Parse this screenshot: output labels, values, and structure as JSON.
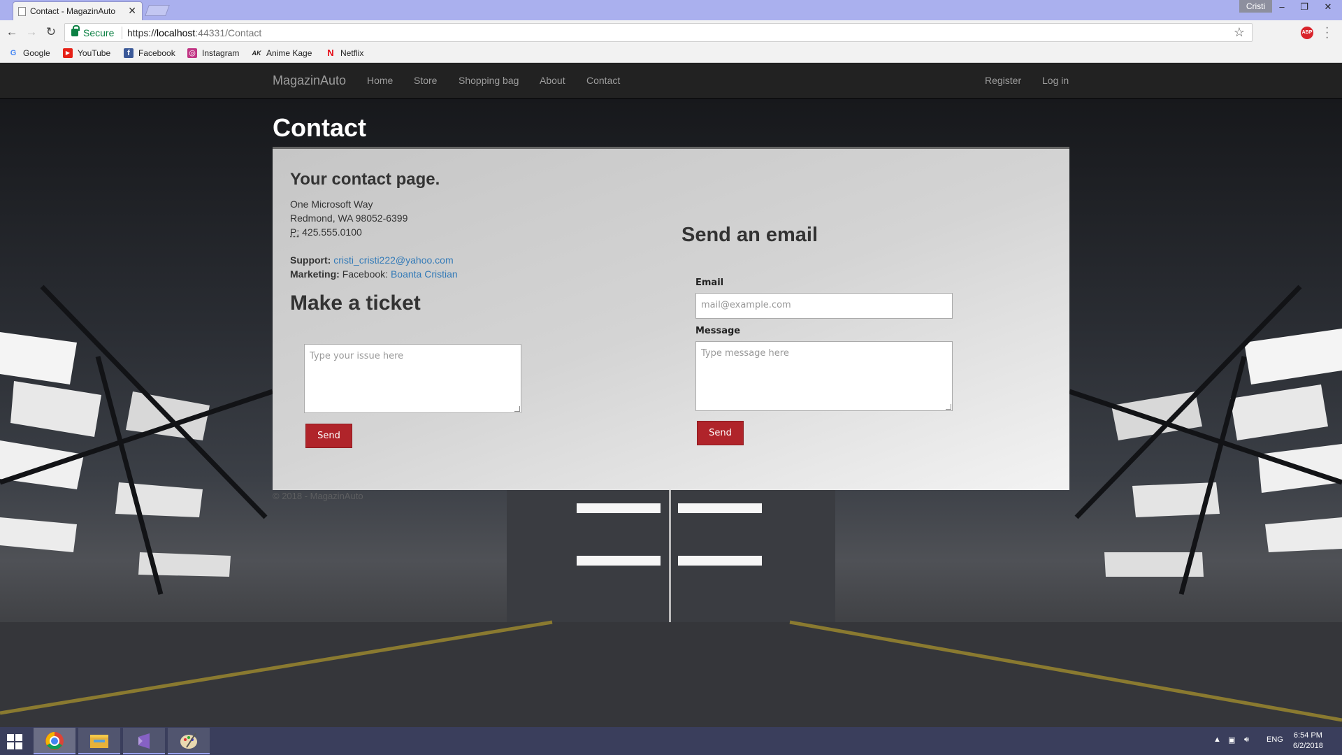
{
  "browser": {
    "tab_title": "Contact - MagazinAuto",
    "tab_close": "✕",
    "profile": "Cristi",
    "secure_label": "Secure",
    "url_scheme": "https://",
    "url_host": "localhost",
    "url_rest": ":44331/Contact",
    "bookmarks": [
      {
        "label": "Google",
        "icon": "G",
        "color": "#4285f4"
      },
      {
        "label": "YouTube",
        "icon": "▶",
        "color": "#e62117"
      },
      {
        "label": "Facebook",
        "icon": "f",
        "color": "#3b5998"
      },
      {
        "label": "Instagram",
        "icon": "◎",
        "color": "#c13584"
      },
      {
        "label": "Anime Kage",
        "icon": "AK",
        "color": "#222222"
      },
      {
        "label": "Netflix",
        "icon": "N",
        "color": "#e50914"
      }
    ]
  },
  "site": {
    "brand": "MagazinAuto",
    "nav": [
      "Home",
      "Store",
      "Shopping bag",
      "About",
      "Contact"
    ],
    "nav_right": [
      "Register",
      "Log in"
    ],
    "page_title": "Contact",
    "contact": {
      "heading": "Your contact page.",
      "address_line1": "One Microsoft Way",
      "address_line2": "Redmond, WA 98052-6399",
      "phone_abbr": "P:",
      "phone": "425.555.0100",
      "support_label": "Support:",
      "support_email": "cristi_cristi222@yahoo.com",
      "marketing_label": "Marketing:",
      "marketing_text": "Facebook:",
      "marketing_link": "Boanta Cristian"
    },
    "ticket": {
      "heading": "Make a ticket",
      "placeholder": "Type your issue here",
      "send": "Send"
    },
    "email_form": {
      "heading": "Send an email",
      "email_label": "Email",
      "email_placeholder": "mail@example.com",
      "message_label": "Message",
      "message_placeholder": "Type message here",
      "send": "Send"
    },
    "footer": "© 2018 - MagazinAuto"
  },
  "taskbar": {
    "lang": "ENG",
    "time": "6:54 PM",
    "date": "6/2/2018"
  }
}
